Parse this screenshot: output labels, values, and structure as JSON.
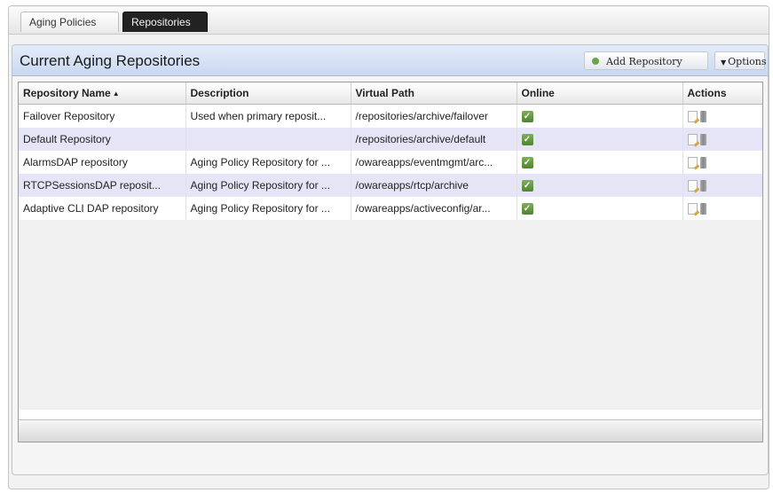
{
  "tabs": [
    {
      "label": "Aging Policies",
      "active": false
    },
    {
      "label": "Repositories",
      "active": true
    }
  ],
  "panel": {
    "title": "Current Aging Repositories",
    "add_button": "Add Repository",
    "options_button": "Options"
  },
  "table": {
    "columns": [
      "Repository Name",
      "Description",
      "Virtual Path",
      "Online",
      "Actions"
    ],
    "sort_indicator": "▲",
    "rows": [
      {
        "name": "Failover Repository",
        "description": "Used when primary reposit...",
        "path": "/repositories/archive/failover",
        "online": true
      },
      {
        "name": "Default Repository",
        "description": "",
        "path": "/repositories/archive/default",
        "online": true
      },
      {
        "name": "AlarmsDAP repository",
        "description": "Aging Policy Repository for ...",
        "path": "/owareapps/eventmgmt/arc...",
        "online": true
      },
      {
        "name": "RTCPSessionsDAP reposit...",
        "description": "Aging Policy Repository for ...",
        "path": "/owareapps/rtcp/archive",
        "online": true
      },
      {
        "name": "Adaptive CLI DAP repository",
        "description": "Aging Policy Repository for ...",
        "path": "/owareapps/activeconfig/ar...",
        "online": true
      }
    ]
  },
  "icons": {
    "add": "plus-circle-icon",
    "options": "triangle-down-icon",
    "online": "checkbox-checked-icon",
    "edit": "edit-document-icon",
    "delete": "trash-icon"
  },
  "colors": {
    "header_gradient_top": "#e4ecfa",
    "header_gradient_bottom": "#c9d8f1",
    "alt_row": "#e5e5f7",
    "online_green": "#5a9440",
    "active_tab": "#222222"
  }
}
